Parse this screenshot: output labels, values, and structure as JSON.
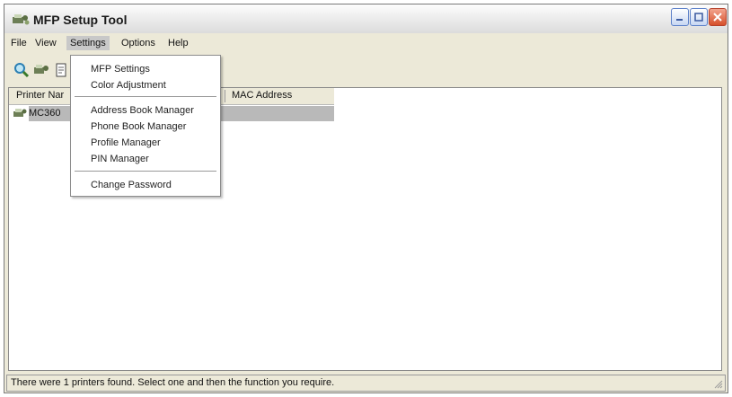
{
  "window": {
    "title": "MFP Setup Tool"
  },
  "menubar": {
    "items": [
      "File",
      "View",
      "Settings",
      "Options",
      "Help"
    ],
    "active": "Settings"
  },
  "toolbar": {
    "icons": [
      "search-icon",
      "printer-network-icon",
      "document-icon"
    ]
  },
  "list": {
    "columns": [
      "Printer Nar",
      "MAC Address"
    ],
    "rows": [
      {
        "name": "MC360",
        "selected": true
      }
    ]
  },
  "settings_menu": {
    "groups": [
      [
        "MFP Settings",
        "Color Adjustment"
      ],
      [
        "Address Book Manager",
        "Phone Book Manager",
        "Profile Manager",
        "PIN Manager"
      ],
      [
        "Change Password"
      ]
    ]
  },
  "status": {
    "text": "There were 1 printers found. Select one and then the function you require."
  },
  "colors": {
    "selection": "#b9b9b9",
    "window_bg": "#ece9d8",
    "close_button": "#d6502b"
  }
}
